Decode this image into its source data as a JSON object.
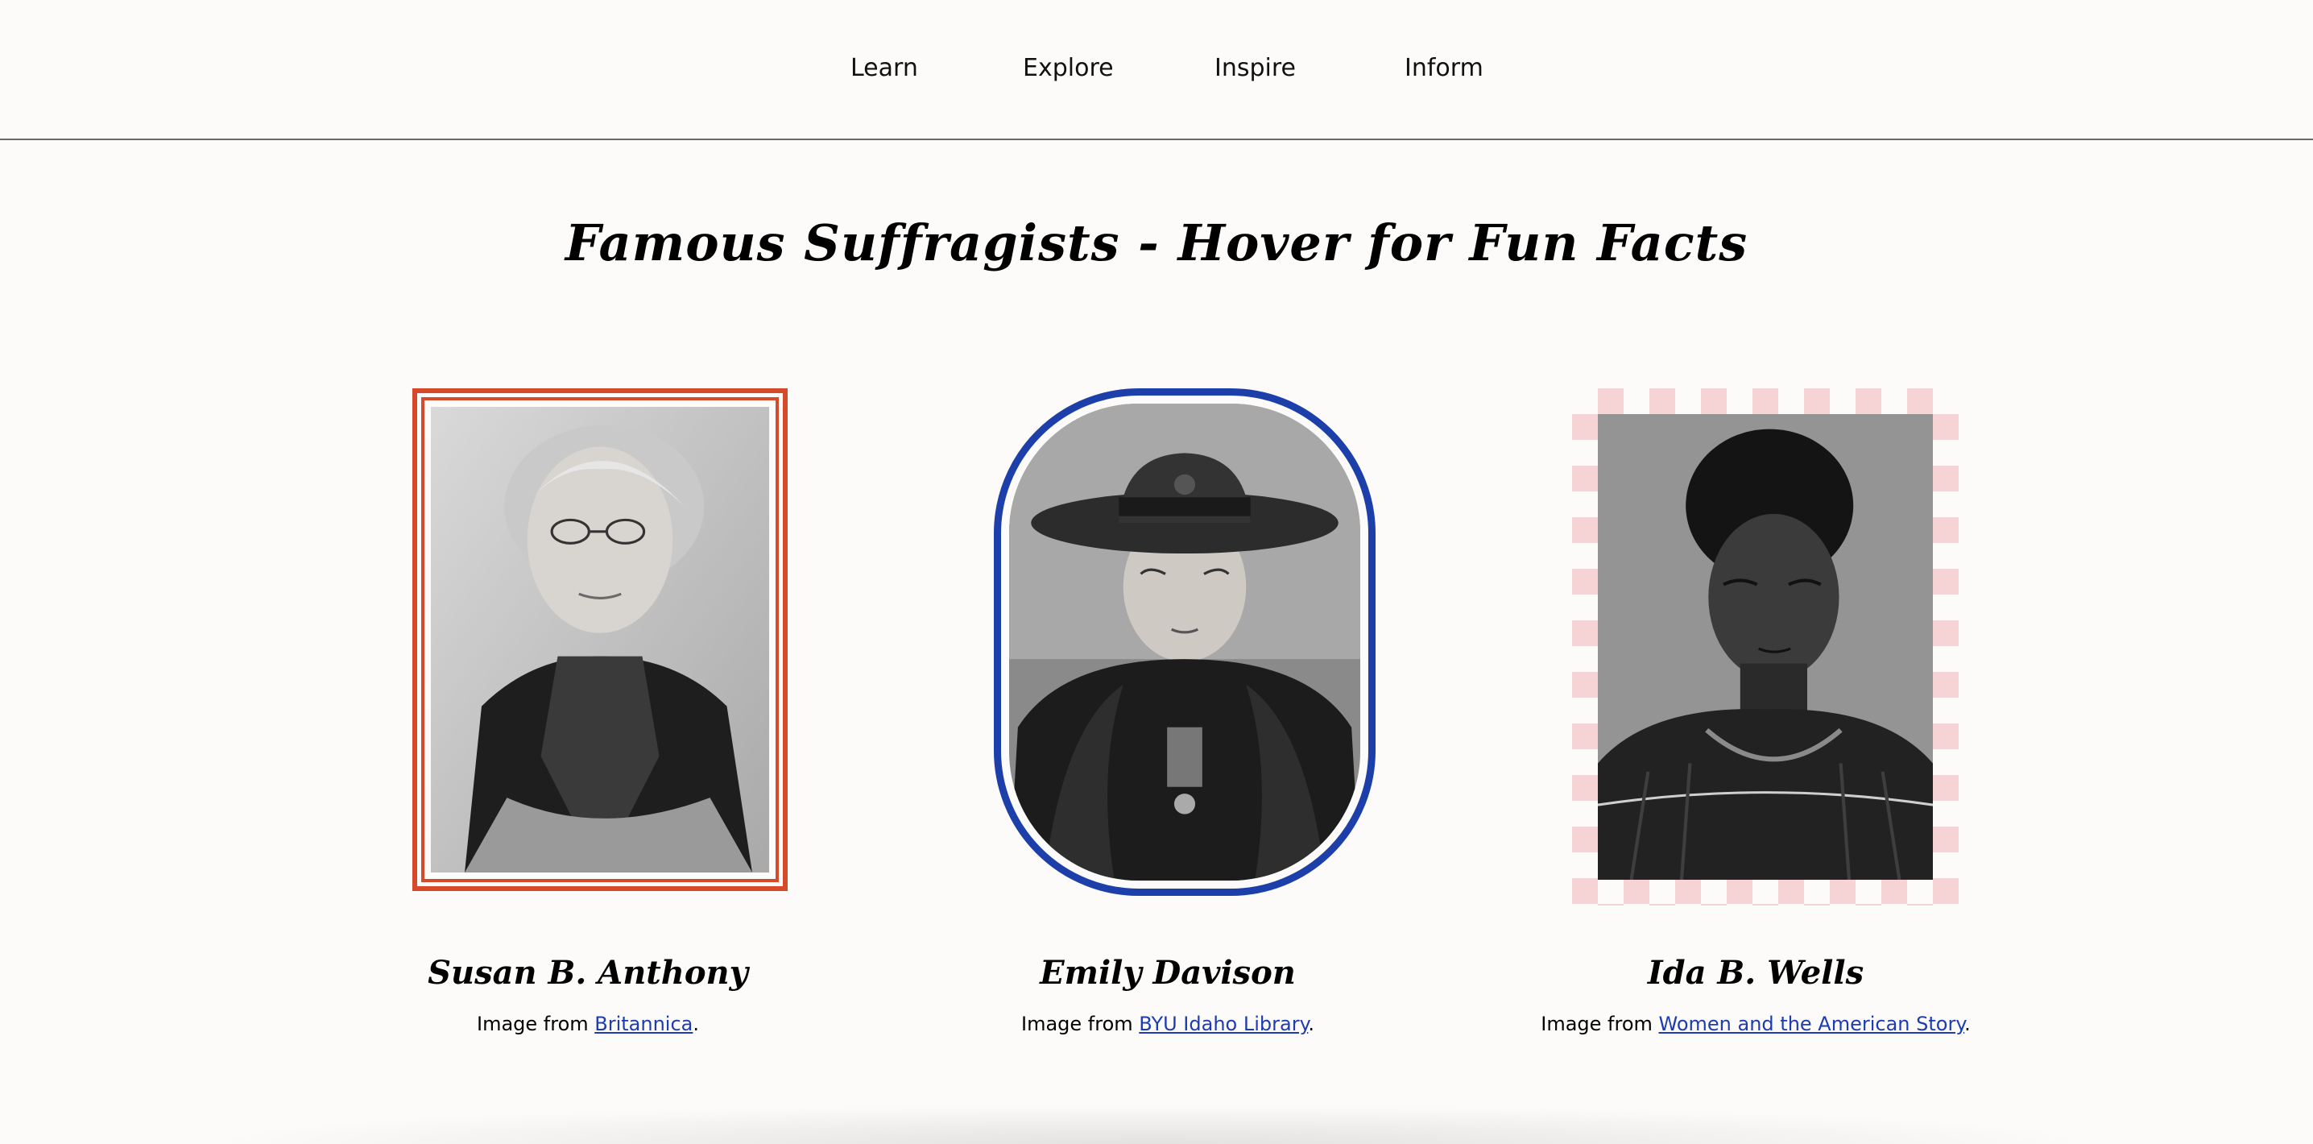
{
  "nav": {
    "items": [
      {
        "label": "Learn"
      },
      {
        "label": "Explore"
      },
      {
        "label": "Inspire"
      },
      {
        "label": "Inform"
      }
    ]
  },
  "main": {
    "title": "Famous Suffragists - Hover for Fun Facts",
    "cards": [
      {
        "name": "Susan B. Anthony",
        "credit_prefix": "Image from ",
        "credit_link": "Britannica",
        "credit_suffix": ".",
        "frame_color": "#d64a2b"
      },
      {
        "name": "Emily Davison",
        "credit_prefix": "Image from ",
        "credit_link": "BYU Idaho Library",
        "credit_suffix": ".",
        "frame_color": "#1c3faa"
      },
      {
        "name": "Ida B. Wells",
        "credit_prefix": "Image from ",
        "credit_link": "Women and the American Story",
        "credit_suffix": ".",
        "frame_color": "#f6d3d5"
      }
    ]
  },
  "colors": {
    "background": "#fdfbfa",
    "link": "#1d3bb2",
    "nav_rule": "#6a6a6a"
  },
  "icons": [
    "portrait-photo-icon"
  ]
}
